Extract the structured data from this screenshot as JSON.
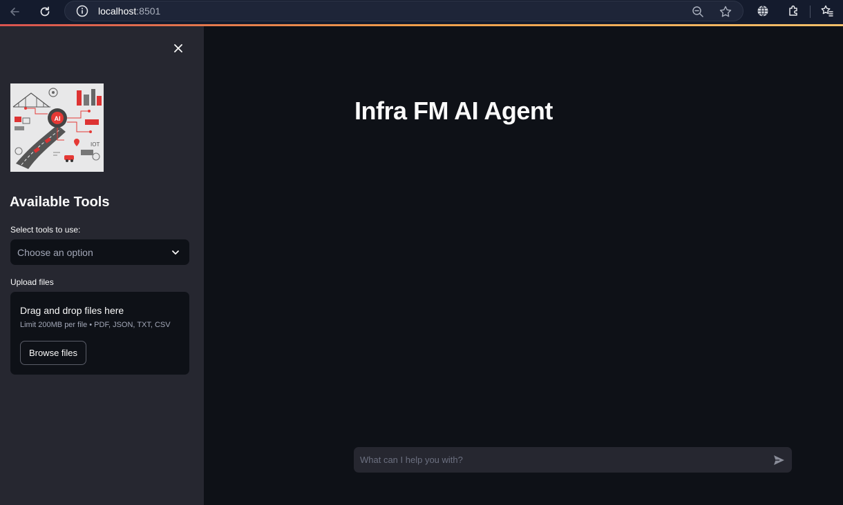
{
  "browser": {
    "url_host": "localhost",
    "url_port": ":8501"
  },
  "sidebar": {
    "heading": "Available Tools",
    "tools_label": "Select tools to use:",
    "tools_placeholder": "Choose an option",
    "upload_label": "Upload files",
    "upload_title": "Drag and drop files here",
    "upload_limits": "Limit 200MB per file • PDF, JSON, TXT, CSV",
    "browse_label": "Browse files",
    "logo_text": [
      "AI",
      "IOT"
    ]
  },
  "main": {
    "title": "Infra FM AI Agent",
    "chat_placeholder": "What can I help you with?"
  },
  "colors": {
    "main_bg": "#0e1117",
    "sidebar_bg": "#262730",
    "text": "#fafafa",
    "accent_red": "#e53935"
  }
}
